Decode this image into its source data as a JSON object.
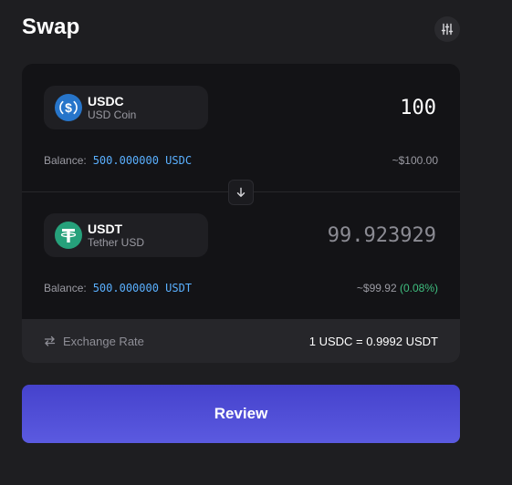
{
  "header": {
    "title": "Swap",
    "settings_icon": "sliders-icon"
  },
  "from": {
    "symbol": "USDC",
    "name": "USD Coin",
    "icon": "usdc-logo",
    "amount": "100",
    "balance_label": "Balance:",
    "balance_value": "500.000000 USDC",
    "usd_value": "~$100.00"
  },
  "to": {
    "symbol": "USDT",
    "name": "Tether USD",
    "icon": "usdt-logo",
    "amount": "99.923929",
    "balance_label": "Balance:",
    "balance_value": "500.000000 USDT",
    "usd_value": "~$99.92",
    "price_impact": "(0.08%)"
  },
  "exchange": {
    "label": "Exchange Rate",
    "value": "1 USDC = 0.9992 USDT"
  },
  "actions": {
    "review_label": "Review"
  },
  "colors": {
    "background": "#1e1e21",
    "card": "#131316",
    "accent": "#5b5ae0",
    "balance": "#5ab0ff",
    "positive": "#3fbf7f",
    "usdc_brand": "#2775ca",
    "usdt_brand": "#26a17b"
  }
}
